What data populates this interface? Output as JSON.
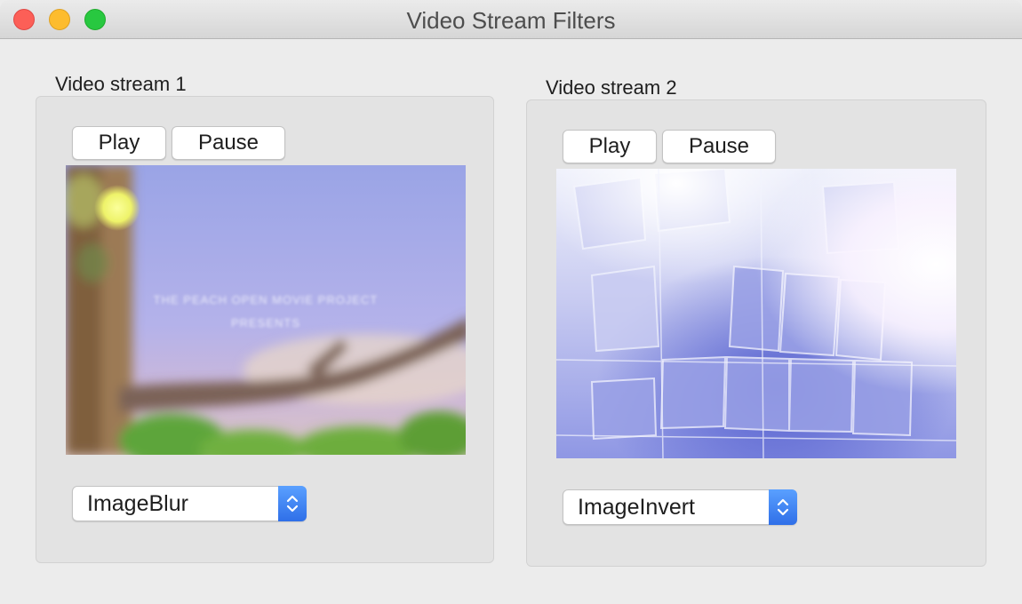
{
  "window": {
    "title": "Video Stream Filters"
  },
  "streams": [
    {
      "label": "Video stream 1",
      "play_label": "Play",
      "pause_label": "Pause",
      "filter_value": "ImageBlur",
      "frame_caption_line1": "THE PEACH OPEN MOVIE PROJECT",
      "frame_caption_line2": "PRESENTS"
    },
    {
      "label": "Video stream 2",
      "play_label": "Play",
      "pause_label": "Pause",
      "filter_value": "ImageInvert"
    }
  ],
  "colors": {
    "accent": "#3478f6",
    "close": "#fc5f57",
    "minimize": "#fdbc2e",
    "maximize": "#28c840"
  }
}
